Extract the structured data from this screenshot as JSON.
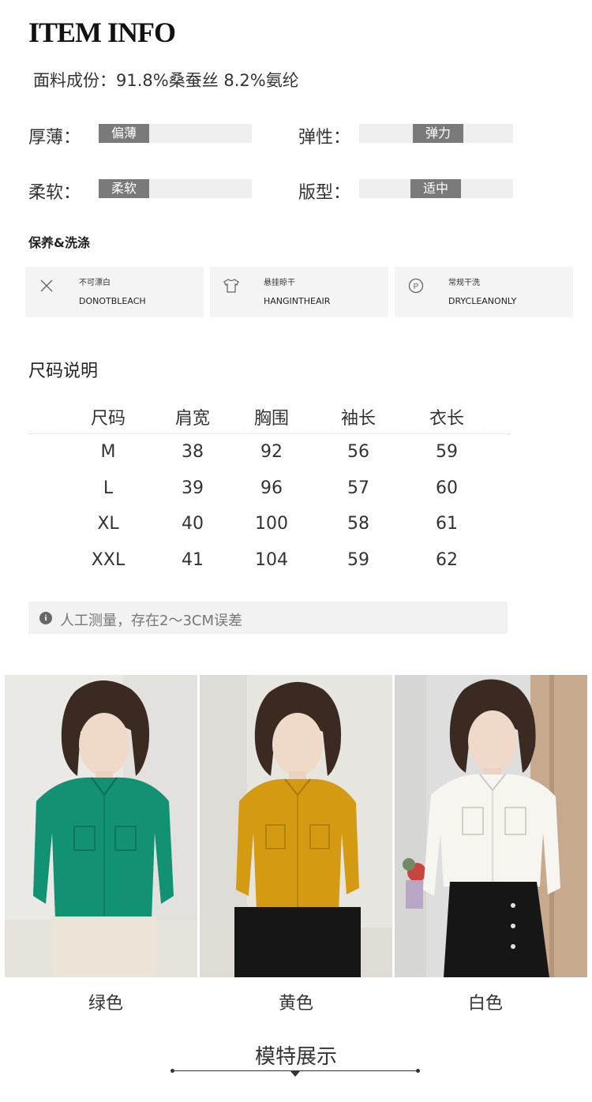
{
  "header": {
    "title": "ITEM INFO",
    "fabric": "面料成份：91.8%桑蚕丝 8.2%氨纶"
  },
  "attributes": [
    {
      "label": "厚薄：",
      "value": "偏薄"
    },
    {
      "label": "弹性：",
      "value": "弹力"
    },
    {
      "label": "柔软：",
      "value": "柔软"
    },
    {
      "label": "版型：",
      "value": "适中"
    }
  ],
  "care": {
    "title": "保养&洗涤",
    "items": [
      {
        "icon": "no-bleach-icon",
        "cn": "不可漂白",
        "en": "DONOTBLEACH"
      },
      {
        "icon": "hang-dry-shirt-icon",
        "cn": "悬挂晾干",
        "en": "HANGINTHEAIR"
      },
      {
        "icon": "dry-clean-p-icon",
        "cn": "常规干洗",
        "en": "DRYCLEANONLY"
      }
    ]
  },
  "size_chart": {
    "title": "尺码说明",
    "headers": [
      "尺码",
      "肩宽",
      "胸围",
      "袖长",
      "衣长"
    ],
    "rows": [
      [
        "M",
        "38",
        "92",
        "56",
        "59"
      ],
      [
        "L",
        "39",
        "96",
        "57",
        "60"
      ],
      [
        "XL",
        "40",
        "100",
        "58",
        "61"
      ],
      [
        "XXL",
        "41",
        "104",
        "59",
        "62"
      ]
    ],
    "note": "人工测量，存在2～3CM误差",
    "note_icon": "info-icon"
  },
  "colors": [
    {
      "name": "绿色",
      "shirt": "#139173",
      "bg": "#e9e9e7",
      "bottom": "#ece4d6"
    },
    {
      "name": "黄色",
      "shirt": "#d49a12",
      "bg": "#e6e4df",
      "bottom": "#161616"
    },
    {
      "name": "白色",
      "shirt": "#f7f5f0",
      "bg": "#dcdcdc",
      "bottom": "#161616"
    }
  ],
  "model_section": {
    "title": "模特展示"
  }
}
